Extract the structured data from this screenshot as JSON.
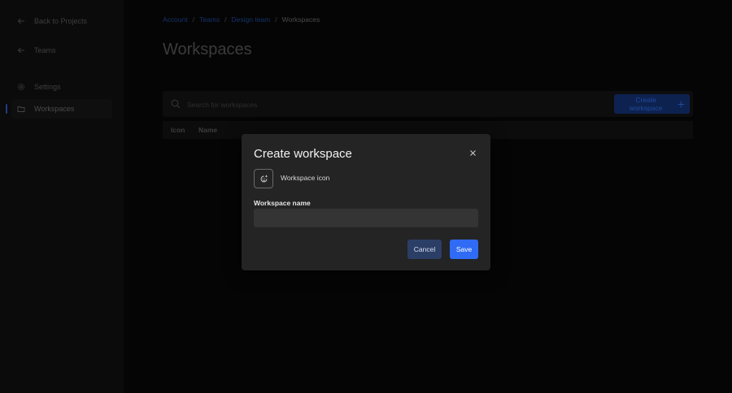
{
  "sidebar": {
    "items": [
      {
        "label": "Back to Projects",
        "icon": "arrow-left-icon"
      },
      {
        "label": "Teams",
        "icon": "arrow-left-icon"
      },
      {
        "label": "Settings",
        "icon": "gear-icon"
      },
      {
        "label": "Workspaces",
        "icon": "folder-icon",
        "active": true
      }
    ]
  },
  "breadcrumb": {
    "items": [
      "Account",
      "Teams",
      "Design team"
    ],
    "separator": "/",
    "current": "Workspaces"
  },
  "main": {
    "title": "Workspaces",
    "search_placeholder": "Search for workspaces",
    "create_button_label": "Create workspace",
    "table_headers": [
      "Icon",
      "Name"
    ]
  },
  "modal": {
    "title": "Create workspace",
    "icon_picker_label": "Workspace icon",
    "field_label": "Workspace name",
    "field_value": "",
    "cancel_label": "Cancel",
    "save_label": "Save"
  },
  "colors": {
    "accent": "#2f6bf5",
    "modal_bg": "#242424",
    "cancel_bg": "#2b3e66"
  }
}
